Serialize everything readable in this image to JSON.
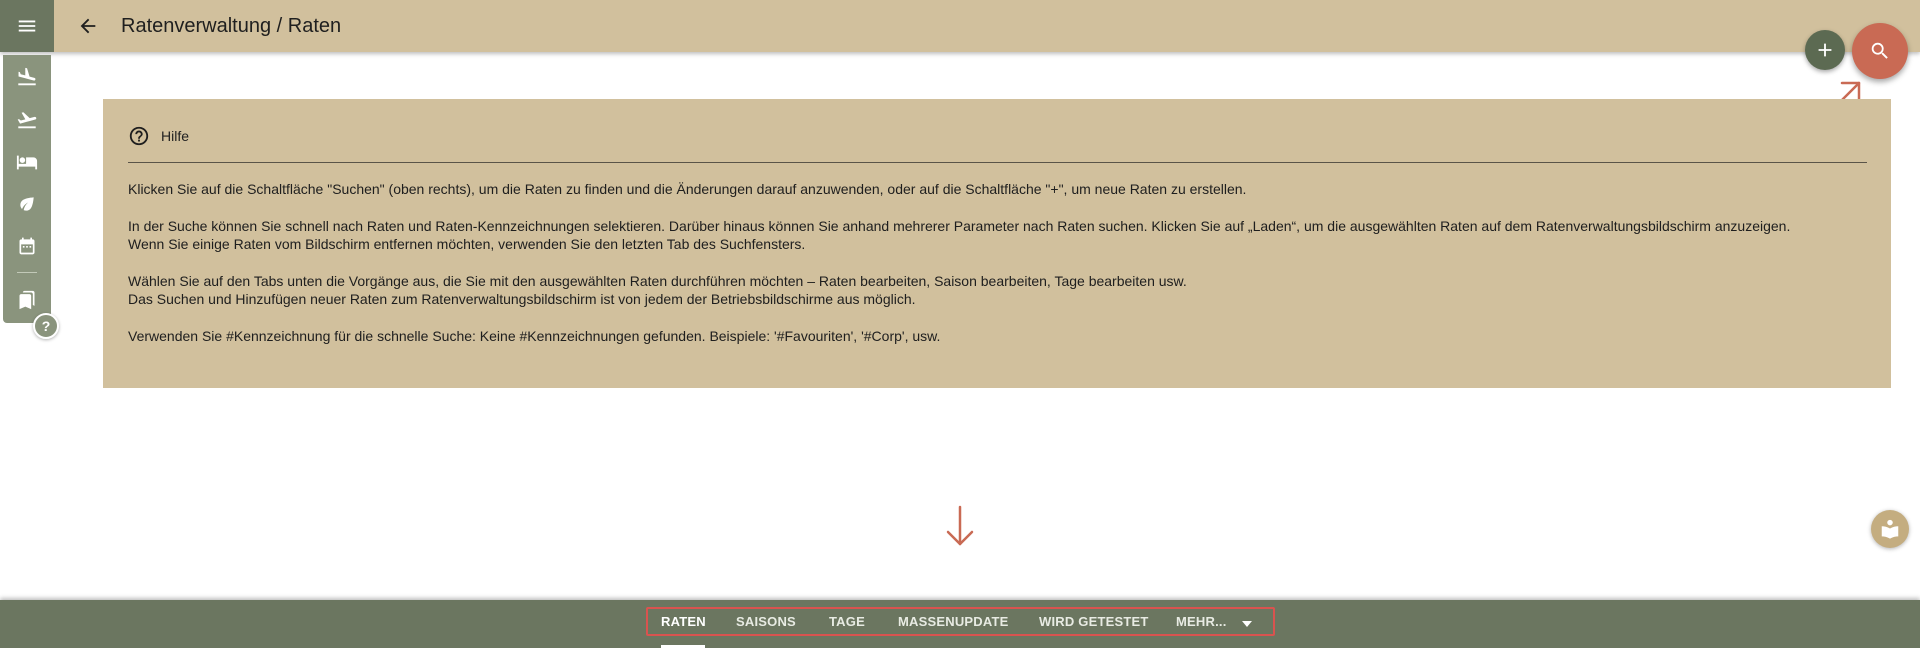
{
  "header": {
    "title": "Ratenverwaltung / Raten",
    "menu_icon": "menu-icon",
    "back_icon": "arrow-back-icon"
  },
  "rail": {
    "items": [
      {
        "icon": "flight-land-icon"
      },
      {
        "icon": "flight-takeoff-icon"
      },
      {
        "icon": "hotel-bed-icon"
      },
      {
        "icon": "leaf-icon"
      },
      {
        "icon": "calendar-icon"
      },
      {
        "icon": "bookmarks-icon"
      }
    ],
    "help_label": "?"
  },
  "fabs": {
    "add_icon": "plus-icon",
    "search_icon": "search-icon"
  },
  "help": {
    "title": "Hilfe",
    "paragraphs": {
      "p1": "Klicken Sie auf die Schaltfläche \"Suchen\" (oben rechts), um die Raten zu finden und die Änderungen darauf anzuwenden, oder auf die Schaltfläche \"+\", um neue Raten zu erstellen.",
      "p2_line1": "In der Suche können Sie schnell nach Raten und Raten-Kennzeichnungen selektieren. Darüber hinaus können Sie anhand mehrerer Parameter nach Raten suchen. Klicken Sie auf „Laden“, um die ausgewählten Raten auf dem Ratenverwaltungsbildschirm anzuzeigen.",
      "p2_line2": "Wenn Sie einige Raten vom Bildschirm entfernen möchten, verwenden Sie den letzten Tab des Suchfensters.",
      "p3_line1": "Wählen Sie auf den Tabs unten die Vorgänge aus, die Sie mit den ausgewählten Raten durchführen möchten – Raten bearbeiten, Saison bearbeiten, Tage bearbeiten usw.",
      "p3_line2": "Das Suchen und Hinzufügen neuer Raten zum Ratenverwaltungsbildschirm ist von jedem der Betriebsbildschirme aus möglich.",
      "p4": "Verwenden Sie #Kennzeichnung für die schnelle Suche: Keine #Kennzeichnungen gefunden. Beispiele: '#Favouriten', '#Corp', usw."
    }
  },
  "tabs": {
    "raten": "RATEN",
    "saisons": "SAISONS",
    "tage": "TAGE",
    "massenupdate": "MASSENUPDATE",
    "wird_getestet": "WIRD GETESTET",
    "mehr": "MEHR...",
    "active": "RATEN"
  },
  "colors": {
    "header_bg": "#d1c09d",
    "bottom_bar": "#6b7660",
    "search_fab": "#c96a54",
    "add_fab": "#5c6a52",
    "hint_accent": "#c96a54",
    "tabs_outline": "#d9534f"
  }
}
